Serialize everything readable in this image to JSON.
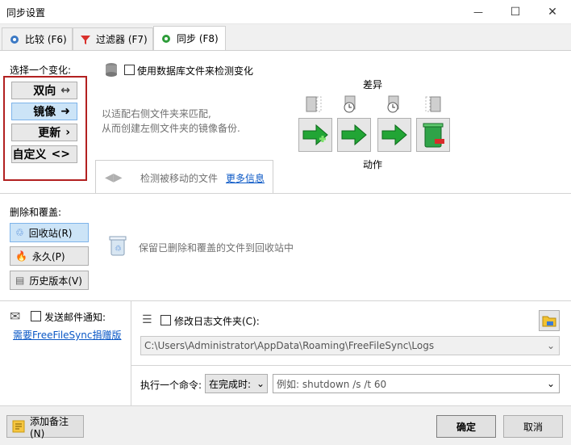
{
  "window": {
    "title": "同步设置",
    "minimize": "—",
    "maximize": "☐",
    "close": "✕"
  },
  "tabs": [
    {
      "label": "比较 (F6)"
    },
    {
      "label": "过滤器 (F7)"
    },
    {
      "label": "同步 (F8)"
    }
  ],
  "variant": {
    "heading": "选择一个变化:",
    "buttons": [
      {
        "label": "双向",
        "glyph": "↔"
      },
      {
        "label": "镜像",
        "glyph": "➜"
      },
      {
        "label": "更新",
        "glyph": "›"
      },
      {
        "label": "自定义",
        "glyph": "<>"
      }
    ],
    "selected": "镜像"
  },
  "database": {
    "label": "使用数据库文件来检测变化"
  },
  "description": {
    "line1": "以适配右侧文件夹来匹配,",
    "line2": "从而创建左侧文件夹的镜像备份."
  },
  "differences": {
    "heading": "差异",
    "actions_heading": "动作"
  },
  "detect_moved": {
    "label": "检测被移动的文件",
    "more_info": "更多信息"
  },
  "deletion": {
    "heading": "删除和覆盖:",
    "options": [
      {
        "label": "回收站(R)"
      },
      {
        "label": "永久(P)"
      },
      {
        "label": "历史版本(V)"
      }
    ],
    "selected": "回收站(R)",
    "description": "保留已删除和覆盖的文件到回收站中"
  },
  "email": {
    "label": "发送邮件通知:",
    "link": "需要FreeFileSync捐赠版"
  },
  "logfolder": {
    "label": "修改日志文件夹(C):",
    "path": "C:\\Users\\Administrator\\AppData\\Roaming\\FreeFileSync\\Logs"
  },
  "command": {
    "label": "执行一个命令:",
    "when": "在完成时:",
    "placeholder": "例如: shutdown /s /t 60"
  },
  "footer": {
    "add_note": "添加备注(N)",
    "ok": "确定",
    "cancel": "取消"
  }
}
